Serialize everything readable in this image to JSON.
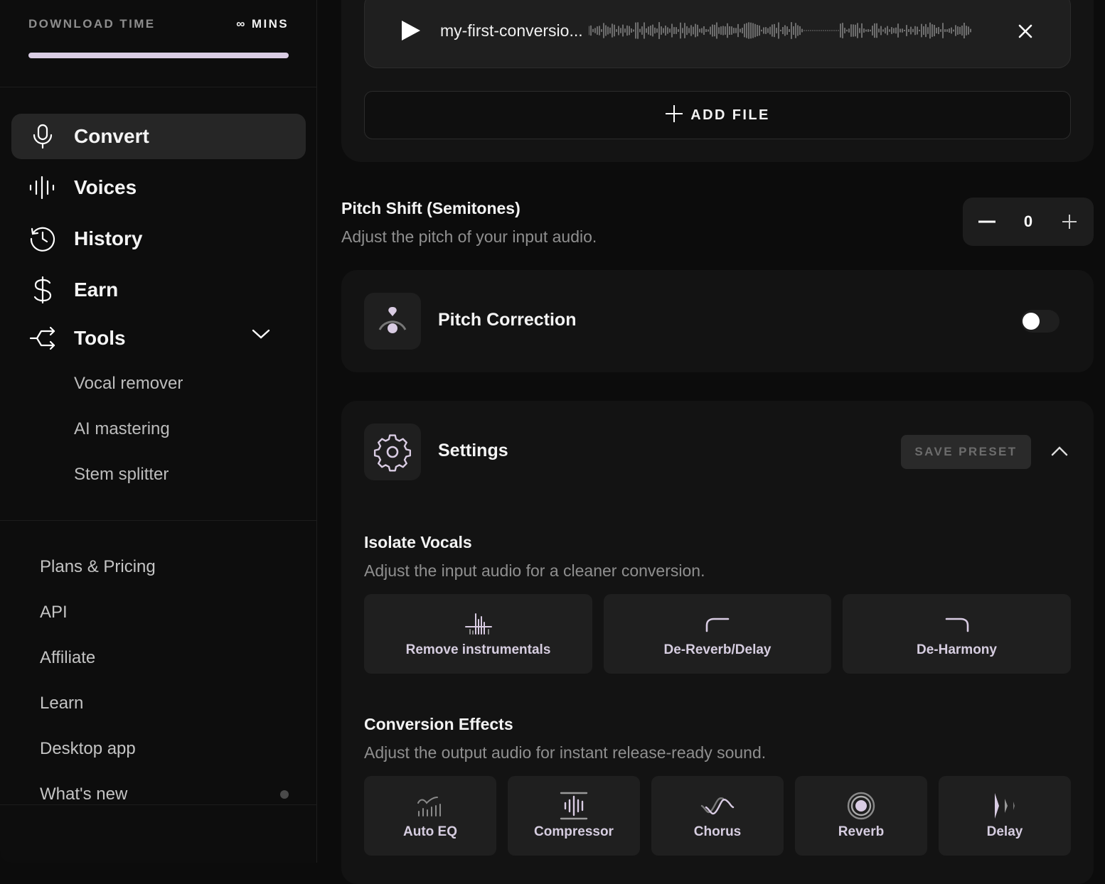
{
  "sidebar": {
    "download": {
      "label": "DOWNLOAD TIME",
      "value": "∞ MINS",
      "progress_percent": 100
    },
    "nav": [
      {
        "label": "Convert",
        "icon": "microphone-icon",
        "active": true
      },
      {
        "label": "Voices",
        "icon": "waveform-icon",
        "active": false
      },
      {
        "label": "History",
        "icon": "history-icon",
        "active": false
      },
      {
        "label": "Earn",
        "icon": "dollar-icon",
        "active": false
      },
      {
        "label": "Tools",
        "icon": "tools-icon",
        "active": false,
        "expanded": true
      }
    ],
    "tools_sub": [
      "Vocal remover",
      "AI mastering",
      "Stem splitter"
    ],
    "footer": [
      "Plans & Pricing",
      "API",
      "Affiliate",
      "Learn",
      "Desktop app",
      "What's new"
    ]
  },
  "upload": {
    "file_name": "my-first-conversio...",
    "add_file_label": "ADD FILE"
  },
  "pitch_shift": {
    "title": "Pitch Shift (Semitones)",
    "subtitle": "Adjust the pitch of your input audio.",
    "value": "0"
  },
  "pitch_correction": {
    "title": "Pitch Correction",
    "enabled": false
  },
  "settings": {
    "title": "Settings",
    "save_preset_label": "SAVE PRESET",
    "isolate": {
      "title": "Isolate Vocals",
      "subtitle": "Adjust the input audio for a cleaner conversion.",
      "options": [
        "Remove instrumentals",
        "De-Reverb/Delay",
        "De-Harmony"
      ]
    },
    "effects": {
      "title": "Conversion Effects",
      "subtitle": "Adjust the output audio for instant release-ready sound.",
      "options": [
        "Auto EQ",
        "Compressor",
        "Chorus",
        "Reverb",
        "Delay"
      ]
    }
  },
  "colors": {
    "accent": "#d9cce3",
    "bg": "#0c0c0c",
    "card": "#131313",
    "tile": "#1f1f1f"
  }
}
